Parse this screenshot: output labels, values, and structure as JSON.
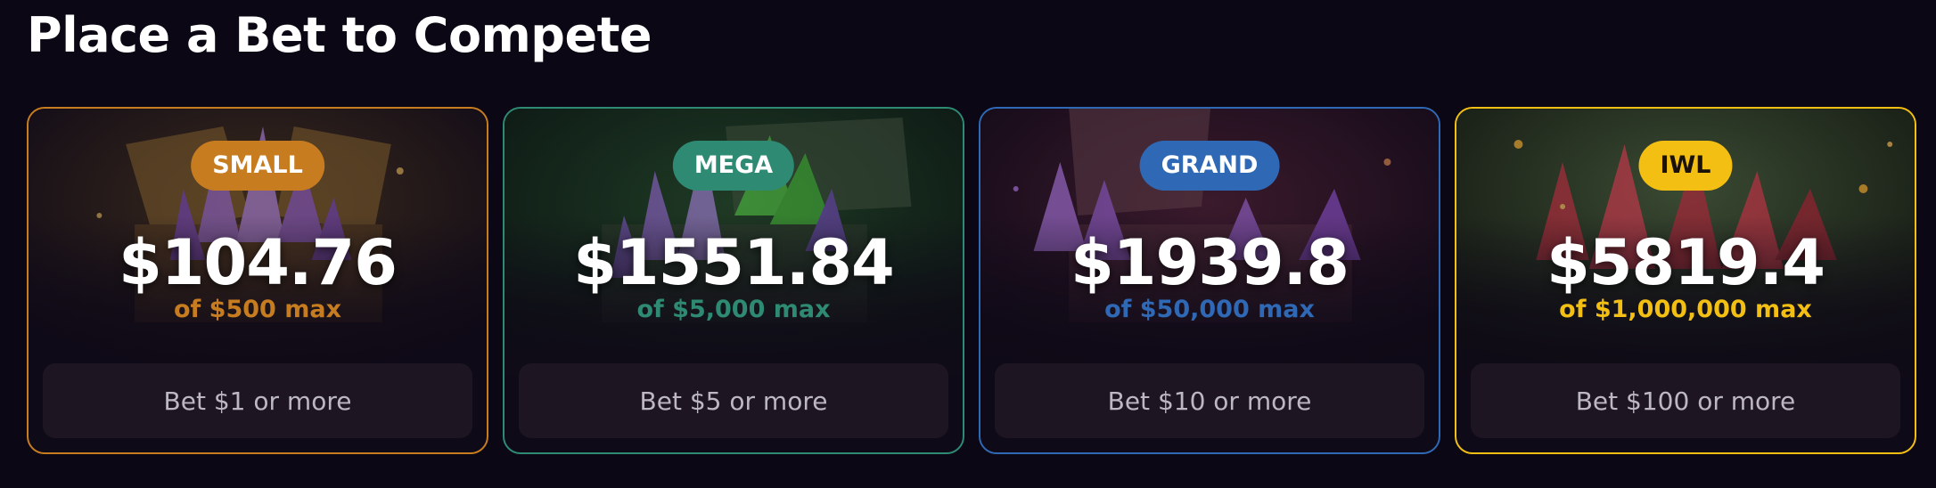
{
  "page": {
    "title": "Place a Bet to Compete"
  },
  "cards": [
    {
      "tier": "SMALL",
      "amount": "$104.76",
      "max": "of $500 max",
      "button": "Bet $1 or more",
      "accent": "#c77d1f",
      "badge_text_color": "#ffffff"
    },
    {
      "tier": "MEGA",
      "amount": "$1551.84",
      "max": "of $5,000 max",
      "button": "Bet $5 or more",
      "accent": "#2e8a73",
      "badge_text_color": "#ffffff"
    },
    {
      "tier": "GRAND",
      "amount": "$1939.8",
      "max": "of $50,000 max",
      "button": "Bet $10 or more",
      "accent": "#2f68b5",
      "badge_text_color": "#ffffff"
    },
    {
      "tier": "IWL",
      "amount": "$5819.4",
      "max": "of $1,000,000 max",
      "button": "Bet $100 or more",
      "accent": "#f2bf12",
      "badge_text_color": "#1a1208"
    }
  ]
}
